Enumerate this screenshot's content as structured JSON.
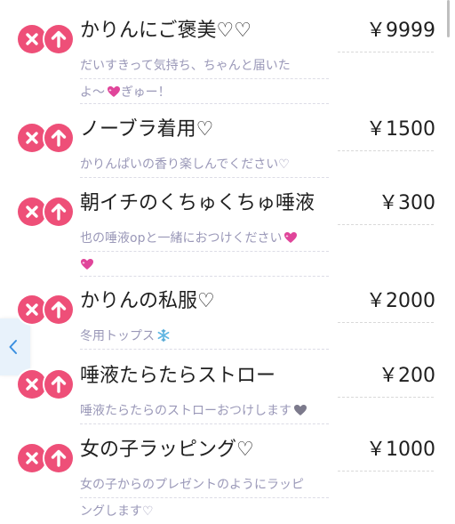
{
  "accent_color": "#ee4f78",
  "icons": {
    "delete": "x-circle-icon",
    "move_up": "arrow-up-circle-icon",
    "back": "chevron-left-icon",
    "heart": "sparkling-heart-icon",
    "snowflake": "snowflake-icon"
  },
  "items": [
    {
      "title": "かりんにご褒美♡♡",
      "price": "￥9999",
      "description": [
        "だいすきって気持ち、ちゃんと届いた",
        "よ〜"
      ],
      "description_suffix": "ぎゅー！"
    },
    {
      "title": "ノーブラ着用♡",
      "price": "￥1500",
      "description": [
        "かりんぱいの香り楽しんでください♡"
      ]
    },
    {
      "title": "朝イチのくちゅくちゅ唾液",
      "price": "￥300",
      "description": [
        "也の唾液opと一緒におつけください"
      ]
    },
    {
      "title": "かりんの私服♡",
      "price": "￥2000",
      "description": [
        "冬用トップス"
      ]
    },
    {
      "title": "唾液たらたらストロー",
      "price": "￥200",
      "description": [
        "唾液たらたらのストローおつけします"
      ]
    },
    {
      "title": "女の子ラッピング♡",
      "price": "￥1000",
      "description": [
        "女の子からのプレゼントのようにラッピ",
        "ングします♡"
      ]
    }
  ]
}
